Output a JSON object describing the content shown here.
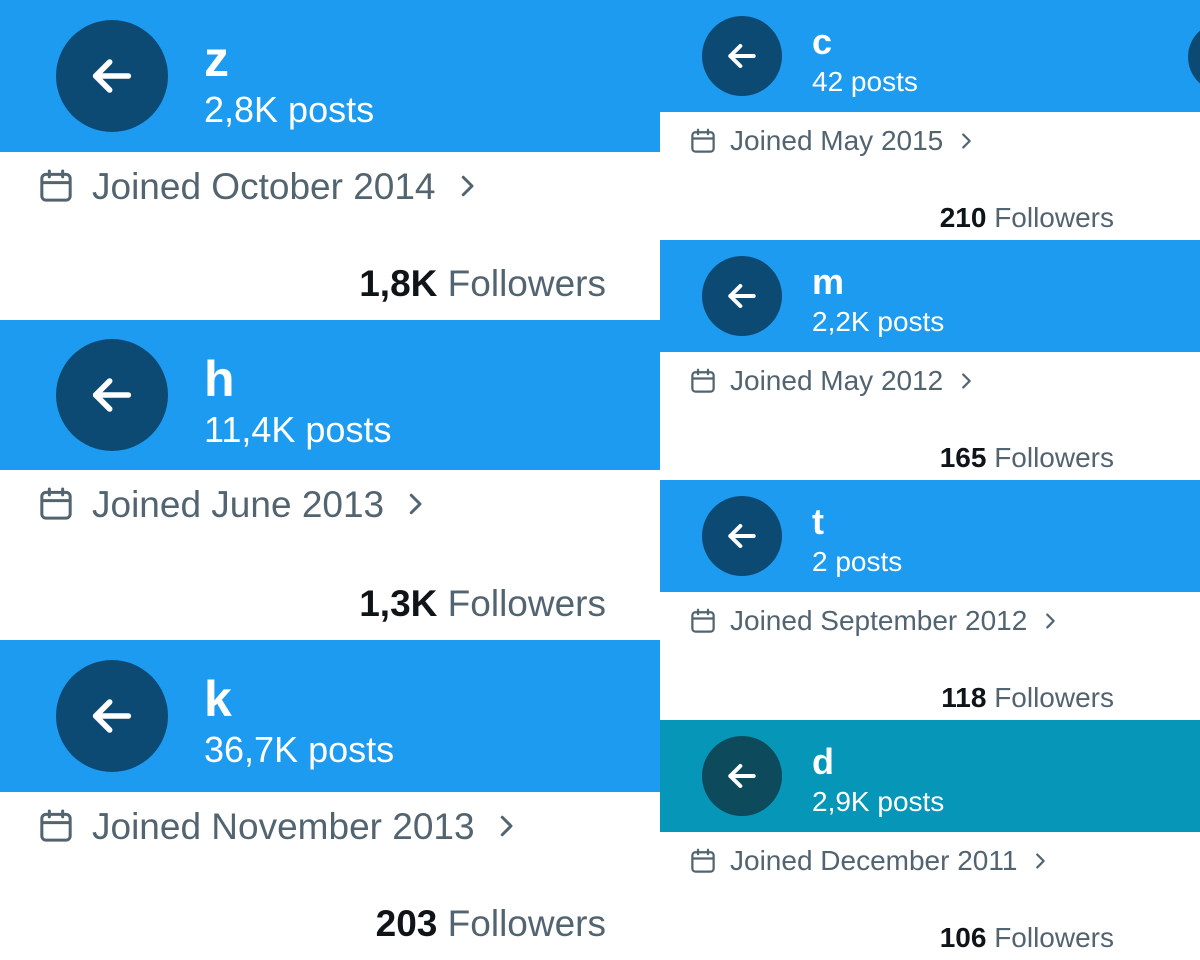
{
  "colors": {
    "header_blue": "#1d9bf0",
    "header_teal": "#0596b8",
    "back_button": "#0d4a73",
    "back_button_teal": "#0c4a5c",
    "muted_text": "#536471",
    "count_text": "#0f1419"
  },
  "icons": {
    "back": "arrow-left-icon",
    "calendar": "calendar-icon",
    "chevron": "chevron-right-icon"
  },
  "profiles": [
    {
      "name": "z",
      "posts": "2,8K posts",
      "joined": "Joined October 2014",
      "followers_count": "1,8K",
      "followers_label": "Followers"
    },
    {
      "name": "h",
      "posts": "11,4K posts",
      "joined": "Joined June 2013",
      "followers_count": "1,3K",
      "followers_label": "Followers"
    },
    {
      "name": "k",
      "posts": "36,7K posts",
      "joined": "Joined November 2013",
      "followers_count": "203",
      "followers_label": "Followers"
    },
    {
      "name": "c",
      "posts": "42 posts",
      "joined": "Joined May 2015",
      "followers_count": "210",
      "followers_label": "Followers"
    },
    {
      "name": "m",
      "posts": "2,2K posts",
      "joined": "Joined May 2012",
      "followers_count": "165",
      "followers_label": "Followers"
    },
    {
      "name": "t",
      "posts": "2 posts",
      "joined": "Joined September 2012",
      "followers_count": "118",
      "followers_label": "Followers"
    },
    {
      "name": "d",
      "posts": "2,9K posts",
      "joined": "Joined December 2011",
      "followers_count": "106",
      "followers_label": "Followers"
    }
  ]
}
